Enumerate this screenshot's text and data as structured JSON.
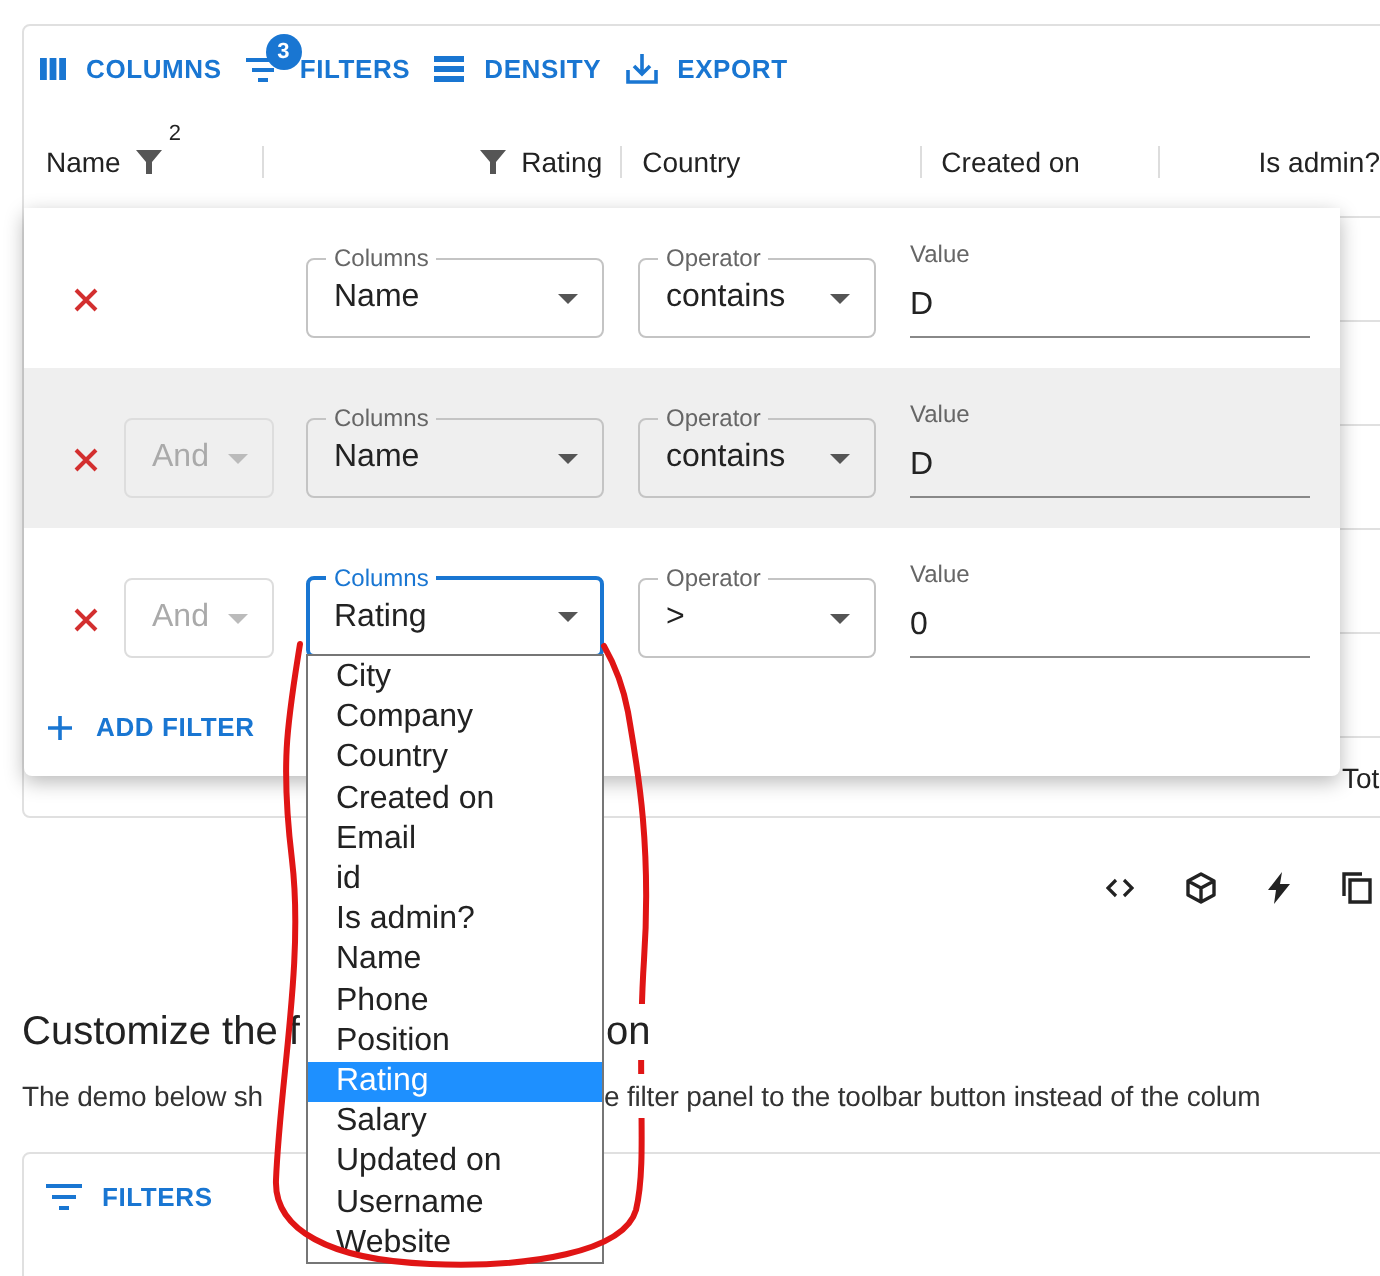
{
  "toolbar": {
    "buttons": [
      {
        "kind": "columns",
        "label": "COLUMNS"
      },
      {
        "kind": "filters",
        "label": "FILTERS",
        "badge": "3"
      },
      {
        "kind": "density",
        "label": "DENSITY"
      },
      {
        "kind": "export",
        "label": "EXPORT"
      }
    ]
  },
  "grid": {
    "columns": [
      {
        "label": "Name",
        "kind": "filter-after",
        "filter_count": "2"
      },
      {
        "label": "Rating",
        "kind": "filter-before"
      },
      {
        "label": "Country",
        "kind": "plain"
      },
      {
        "label": "Created on",
        "kind": "plain"
      },
      {
        "label": "Is admin?",
        "kind": "plain-right"
      }
    ],
    "footer_text": "Tot"
  },
  "filter_panel": {
    "rows": [
      {
        "highlighted": false,
        "columns": {
          "label": "Columns",
          "value": "Name",
          "focused": false
        },
        "operator": {
          "label": "Operator",
          "value": "contains"
        },
        "value": {
          "label": "Value",
          "value": "D"
        }
      },
      {
        "highlighted": true,
        "logic": {
          "value": "And",
          "disabled": true
        },
        "columns": {
          "label": "Columns",
          "value": "Name",
          "focused": false
        },
        "operator": {
          "label": "Operator",
          "value": "contains"
        },
        "value": {
          "label": "Value",
          "value": "D"
        }
      },
      {
        "highlighted": false,
        "logic": {
          "value": "And",
          "disabled": true
        },
        "columns": {
          "label": "Columns",
          "value": "Rating",
          "focused": true
        },
        "operator": {
          "label": "Operator",
          "value": ">"
        },
        "value": {
          "label": "Value",
          "value": "0"
        }
      }
    ],
    "add_button": "ADD FILTER"
  },
  "dropdown": {
    "options": [
      {
        "label": "City",
        "selected": false
      },
      {
        "label": "Company",
        "selected": false
      },
      {
        "label": "Country",
        "selected": false
      },
      {
        "label": "Created on",
        "selected": false
      },
      {
        "label": "Email",
        "selected": false
      },
      {
        "label": "id",
        "selected": false
      },
      {
        "label": "Is admin?",
        "selected": false
      },
      {
        "label": "Name",
        "selected": false
      },
      {
        "label": "Phone",
        "selected": false
      },
      {
        "label": "Position",
        "selected": false
      },
      {
        "label": "Rating",
        "selected": true
      },
      {
        "label": "Salary",
        "selected": false
      },
      {
        "label": "Updated on",
        "selected": false
      },
      {
        "label": "Username",
        "selected": false
      },
      {
        "label": "Website",
        "selected": false
      }
    ]
  },
  "section": {
    "heading_parts": [
      "Customize the f",
      "on"
    ],
    "description_parts": [
      "The demo below sh",
      "e filter panel to the toolbar button instead of the colum"
    ]
  },
  "grid2": {
    "toolbar_button": "FILTERS"
  }
}
